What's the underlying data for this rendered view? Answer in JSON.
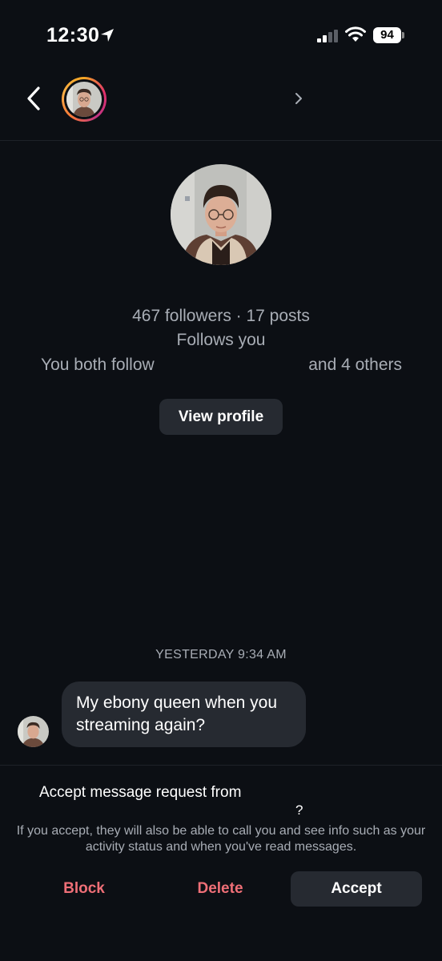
{
  "status_bar": {
    "time": "12:30",
    "battery": "94",
    "icons": [
      "location-arrow-icon",
      "cellular-signal-icon",
      "wifi-icon",
      "battery-icon"
    ]
  },
  "header": {
    "icons": [
      "back-chevron-icon",
      "profile-avatar",
      "forward-chevron-icon"
    ],
    "story_ring_colors": [
      "#f5a623",
      "#e1306c",
      "#c13584"
    ]
  },
  "profile": {
    "stats": "467 followers · 17 posts",
    "follows_you": "Follows you",
    "mutuals_prefix": "You both follow",
    "mutuals_suffix": "and 4 others",
    "view_profile_label": "View profile"
  },
  "conversation": {
    "timestamp": "YESTERDAY 9:34 AM",
    "messages": [
      {
        "text": "My ebony queen when you streaming again?"
      }
    ]
  },
  "request": {
    "title": "Accept message request from",
    "title_end": "?",
    "description": "If you accept, they will also be able to call you and see info such as your activity status and when you've read messages.",
    "block_label": "Block",
    "delete_label": "Delete",
    "accept_label": "Accept"
  },
  "colors": {
    "background": "#0c0f14",
    "surface": "#262a31",
    "secondary_text": "#a8adb5",
    "destructive": "#ef6f77"
  }
}
